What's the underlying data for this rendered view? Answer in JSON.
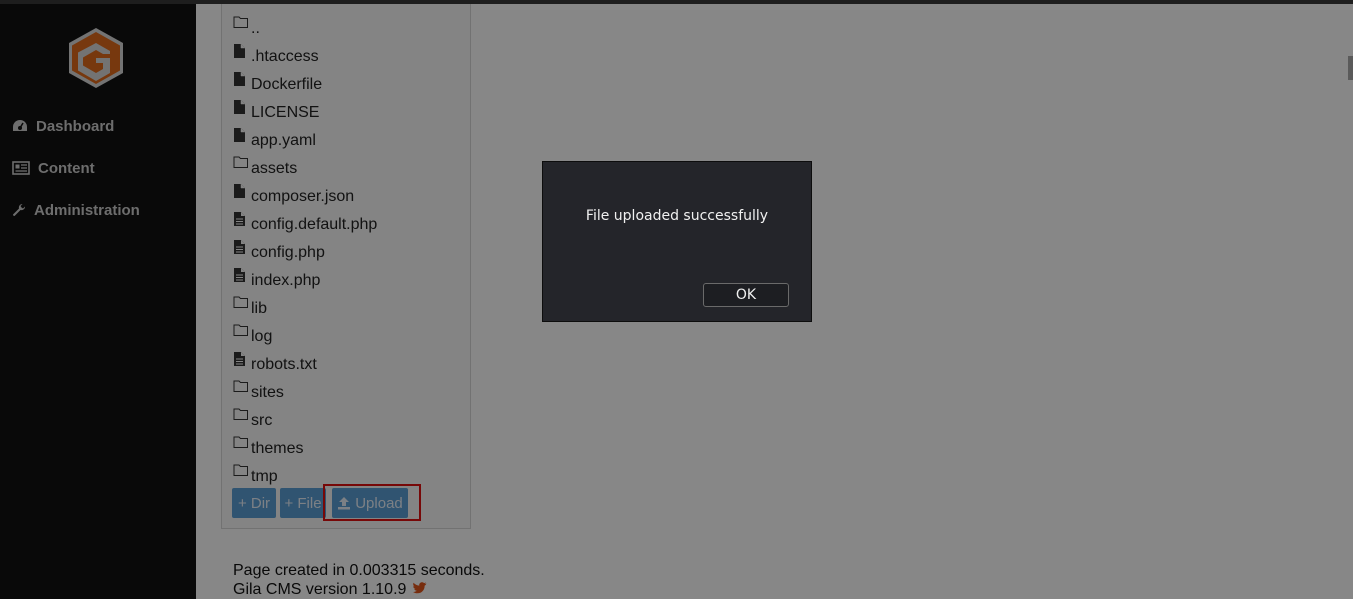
{
  "sidebar": {
    "items": [
      {
        "label": "Dashboard",
        "icon": "dashboard-icon"
      },
      {
        "label": "Content",
        "icon": "content-icon"
      },
      {
        "label": "Administration",
        "icon": "wrench-icon"
      }
    ]
  },
  "file_browser": {
    "entries": [
      {
        "name": "..",
        "type": "folder"
      },
      {
        "name": ".htaccess",
        "type": "file"
      },
      {
        "name": "Dockerfile",
        "type": "file"
      },
      {
        "name": "LICENSE",
        "type": "file"
      },
      {
        "name": "app.yaml",
        "type": "file"
      },
      {
        "name": "assets",
        "type": "folder"
      },
      {
        "name": "composer.json",
        "type": "file"
      },
      {
        "name": "config.default.php",
        "type": "text-file"
      },
      {
        "name": "config.php",
        "type": "text-file"
      },
      {
        "name": "index.php",
        "type": "text-file"
      },
      {
        "name": "lib",
        "type": "folder"
      },
      {
        "name": "log",
        "type": "folder"
      },
      {
        "name": "robots.txt",
        "type": "text-file"
      },
      {
        "name": "sites",
        "type": "folder"
      },
      {
        "name": "src",
        "type": "folder"
      },
      {
        "name": "themes",
        "type": "folder"
      },
      {
        "name": "tmp",
        "type": "folder"
      }
    ],
    "buttons": {
      "add_dir": "+ Dir",
      "add_file": "+ File",
      "upload": "Upload"
    }
  },
  "footer": {
    "page_created": "Page created in 0.003315 seconds.",
    "version": "Gila CMS version 1.10.9"
  },
  "dialog": {
    "message": "File uploaded successfully",
    "ok_label": "OK"
  },
  "colors": {
    "sidebar_bg": "#111111",
    "logo_orange": "#e06a1b",
    "button_blue": "#5b9fd6",
    "highlight_red": "#e01010",
    "dialog_bg": "#24252a"
  }
}
